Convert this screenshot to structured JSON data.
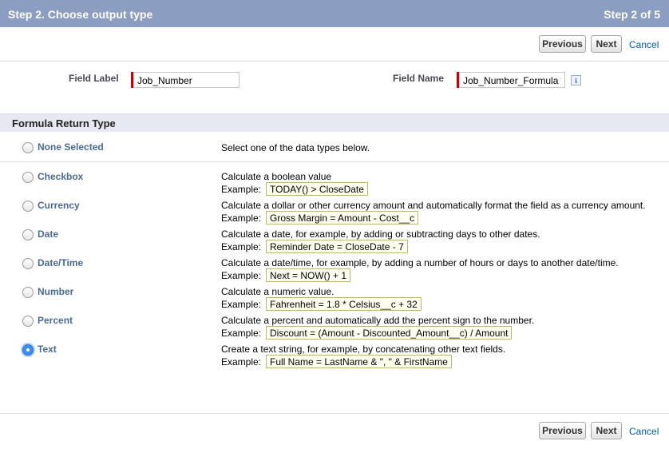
{
  "header": {
    "title": "Step 2. Choose output type",
    "step": "Step 2 of 5"
  },
  "nav": {
    "previous": "Previous",
    "next": "Next",
    "cancel": "Cancel"
  },
  "fields": {
    "field_label": {
      "label": "Field Label",
      "value": "Job_Number"
    },
    "field_name": {
      "label": "Field Name",
      "value": "Job_Number_Formula",
      "info_icon": "info-icon"
    }
  },
  "section": {
    "title": "Formula Return Type"
  },
  "example_label": "Example:",
  "options": [
    {
      "label": "None Selected",
      "description": "Select one of the data types below.",
      "example": "",
      "selected": false
    },
    {
      "label": "Checkbox",
      "description": "Calculate a boolean value",
      "example": "TODAY() > CloseDate",
      "selected": false
    },
    {
      "label": "Currency",
      "description": "Calculate a dollar or other currency amount and automatically format the field as a currency amount.",
      "example": "Gross Margin = Amount - Cost__c",
      "selected": false
    },
    {
      "label": "Date",
      "description": "Calculate a date, for example, by adding or subtracting days to other dates.",
      "example": "Reminder Date = CloseDate - 7",
      "selected": false
    },
    {
      "label": "Date/Time",
      "description": "Calculate a date/time, for example, by adding a number of hours or days to another date/time.",
      "example": "Next = NOW() + 1",
      "selected": false
    },
    {
      "label": "Number",
      "description": "Calculate a numeric value.",
      "example": "Fahrenheit = 1.8 * Celsius__c + 32",
      "selected": false
    },
    {
      "label": "Percent",
      "description": "Calculate a percent and automatically add the percent sign to the number.",
      "example": "Discount = (Amount - Discounted_Amount__c) / Amount",
      "selected": false
    },
    {
      "label": "Text",
      "description": "Create a text string, for example, by concatenating other text fields.",
      "example": "Full Name = LastName & \", \" & FirstName",
      "selected": true
    }
  ],
  "colors": {
    "header_bg": "#8b9dc0",
    "link": "#015ba7",
    "required": "#cc0000",
    "option_label": "#4a6a96"
  }
}
